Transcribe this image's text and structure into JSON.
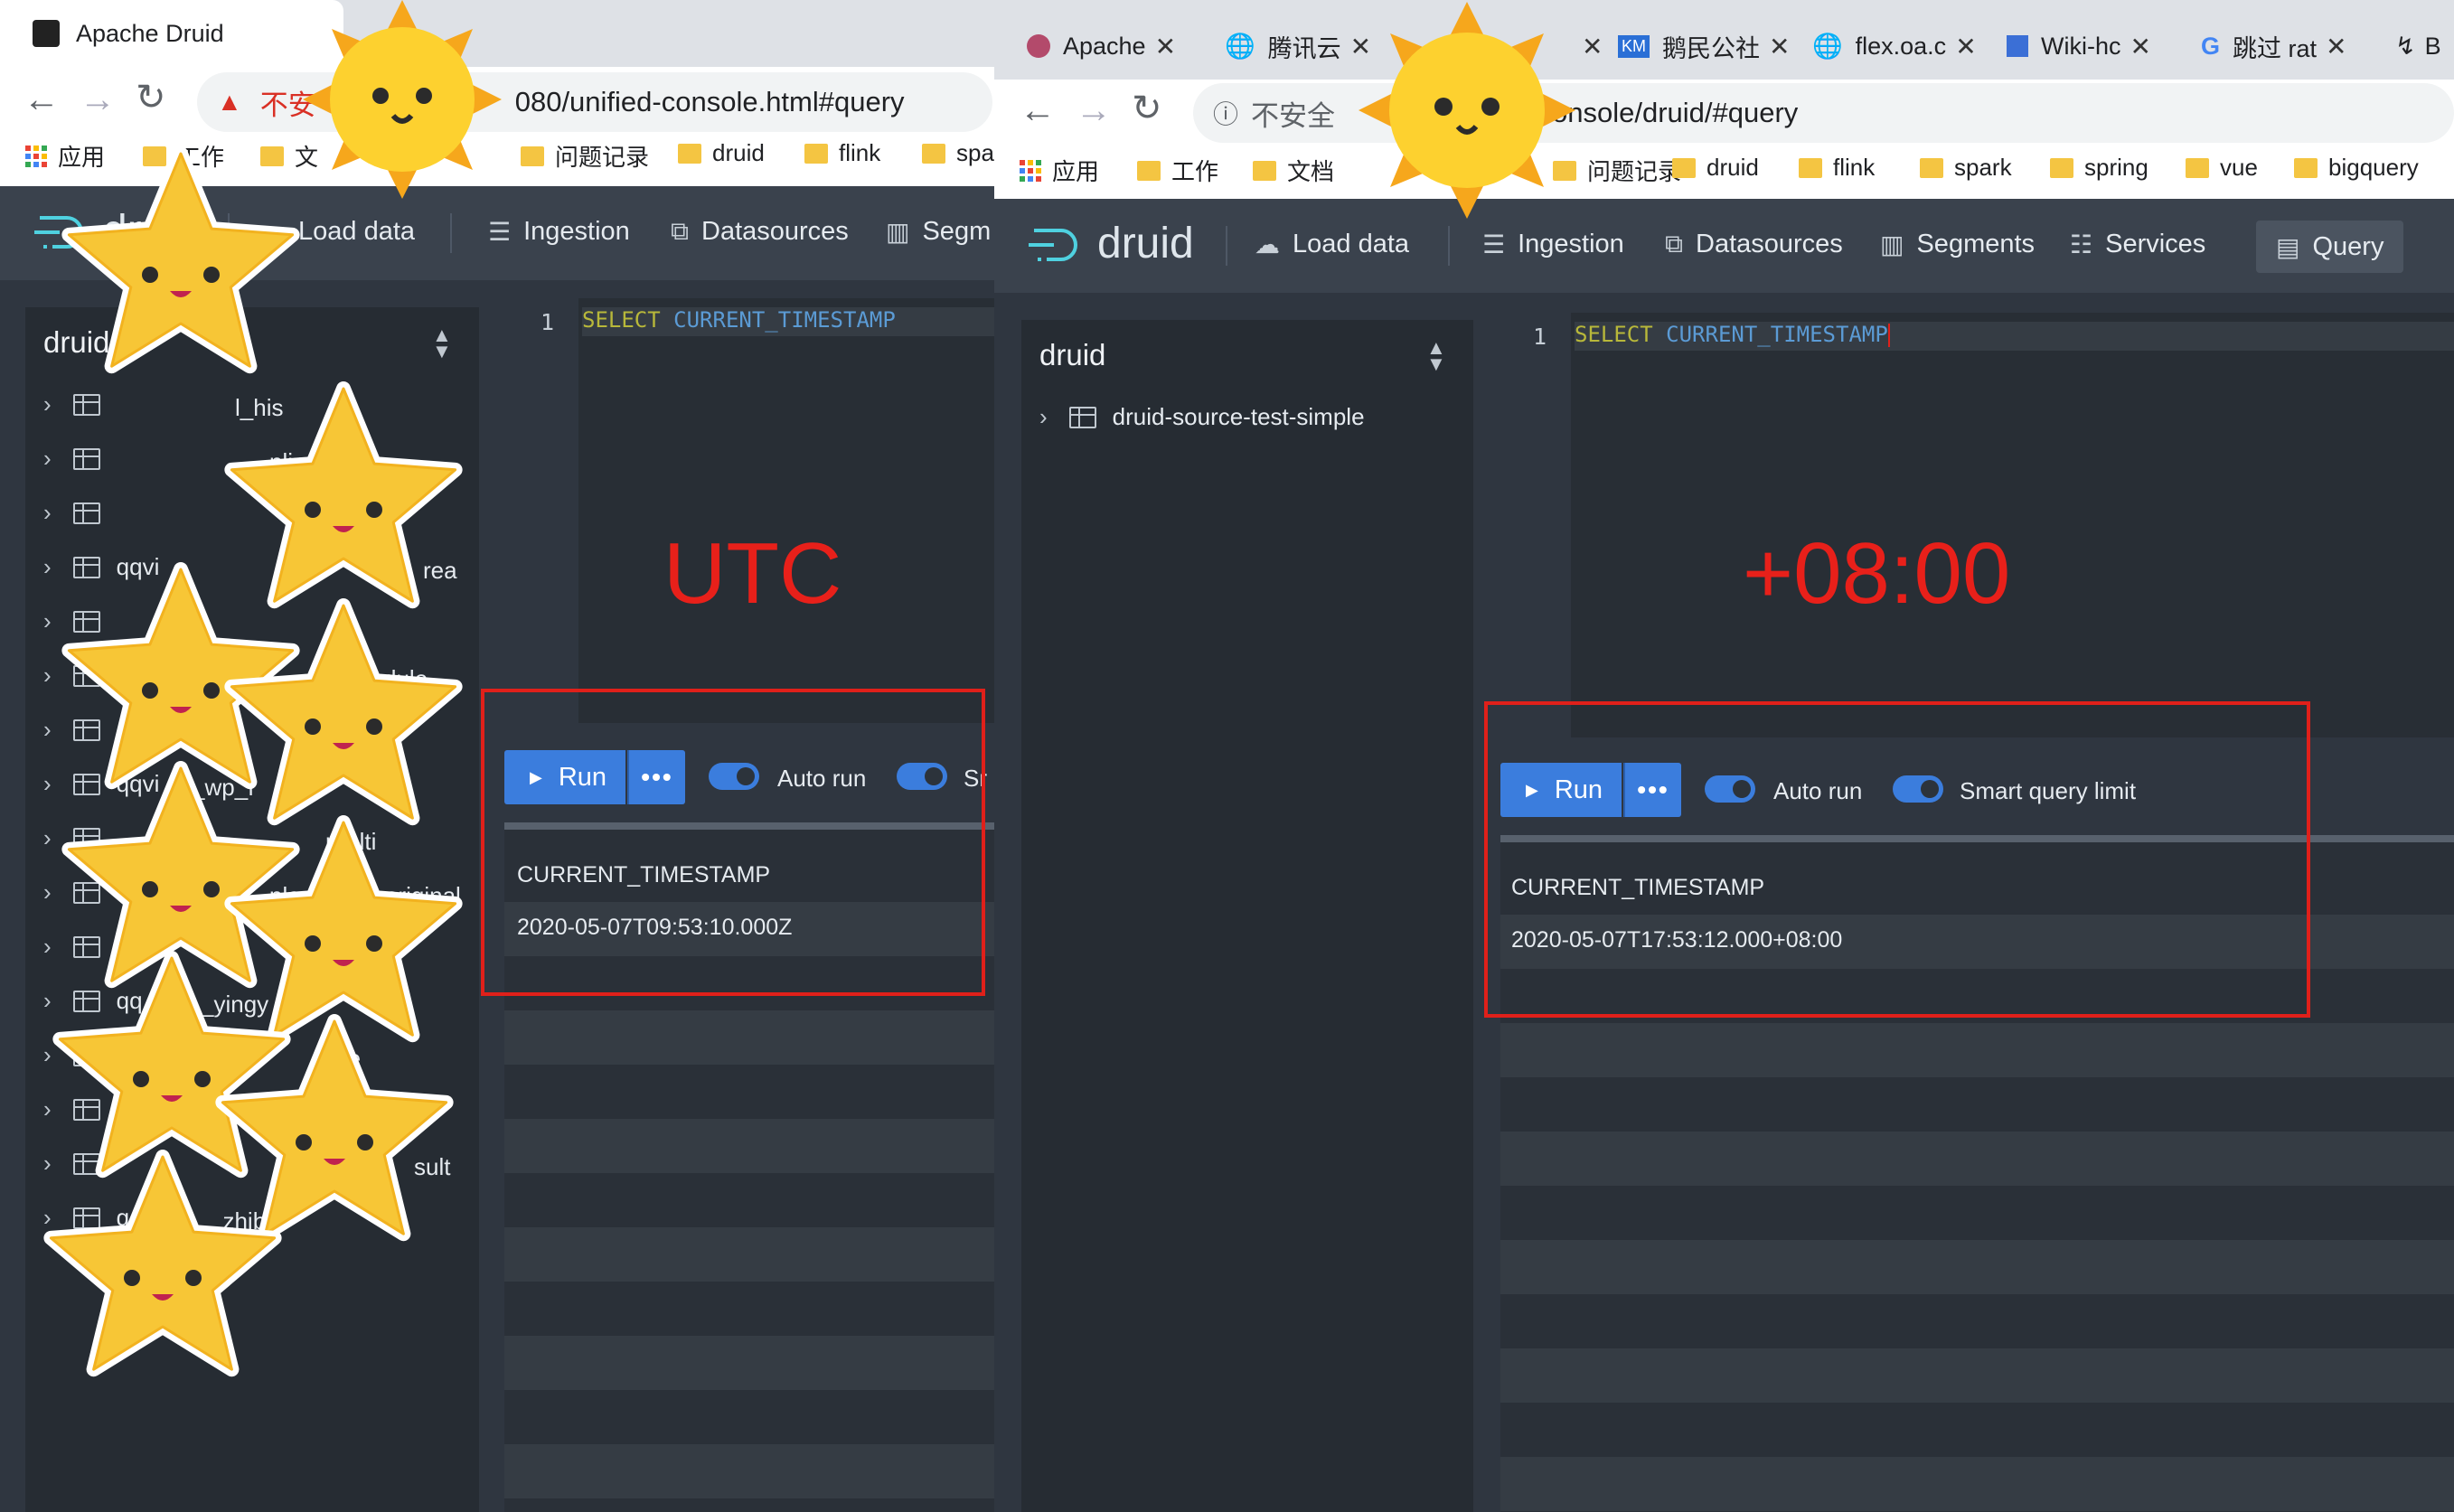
{
  "left_window": {
    "tab_title": "Apache Druid",
    "url_warning": "不安",
    "url_text": "080/unified-console.html#query",
    "bookmarks": [
      "应用",
      "工作",
      "文",
      "问题记录",
      "druid",
      "flink",
      "spa"
    ],
    "nav": [
      "Load data",
      "Ingestion",
      "Datasources",
      "Segm"
    ],
    "logo_text": "druid",
    "sidebar_title": "druid",
    "sidebar_items": [
      "",
      "",
      "",
      "qqvi",
      "",
      "",
      "",
      "qqvi",
      "",
      "",
      "",
      "qq",
      "",
      "",
      "",
      "q"
    ],
    "sidebar_fragments": [
      "l_his",
      "nline",
      "rea",
      "dule",
      "_wp_f",
      "realti",
      "plo",
      "original",
      "_yingy",
      "re",
      "sult",
      "_zhib"
    ],
    "editor": {
      "line_number": "1",
      "keyword": "SELECT",
      "function": "CURRENT_TIMESTAMP"
    },
    "annotation": "UTC",
    "run_label": "Run",
    "more_label": "•••",
    "toggle1_label": "Auto run",
    "toggle2_label": "Sr",
    "result_header": "CURRENT_TIMESTAMP",
    "result_value": "2020-05-07T09:53:10.000Z"
  },
  "right_window": {
    "tabs": [
      {
        "label": "Apache",
        "close": "✕"
      },
      {
        "label": "腾讯云",
        "close": "✕"
      },
      {
        "label": "",
        "close": "✕"
      },
      {
        "label": "鹅民公社",
        "close": "✕"
      },
      {
        "label": "flex.oa.c",
        "close": "✕"
      },
      {
        "label": "Wiki-hc",
        "close": "✕"
      },
      {
        "label": "跳过 rat",
        "close": "✕"
      },
      {
        "label": "B",
        "close": ""
      }
    ],
    "url_warning": "不安全",
    "url_text": "onsole/druid/#query",
    "bookmarks": [
      "应用",
      "工作",
      "文档",
      "问题记录",
      "druid",
      "flink",
      "spark",
      "spring",
      "vue",
      "bigquery"
    ],
    "nav": [
      "Load data",
      "Ingestion",
      "Datasources",
      "Segments",
      "Services",
      "Query"
    ],
    "logo_text": "druid",
    "sidebar_title": "druid",
    "sidebar_items": [
      "druid-source-test-simple"
    ],
    "editor": {
      "line_number": "1",
      "keyword": "SELECT",
      "function": "CURRENT_TIMESTAMP"
    },
    "annotation": "+08:00",
    "run_label": "Run",
    "more_label": "•••",
    "toggle1_label": "Auto run",
    "toggle2_label": "Smart query limit",
    "result_header": "CURRENT_TIMESTAMP",
    "result_value": "2020-05-07T17:53:12.000+08:00"
  },
  "colors": {
    "annotation_red": "#e0201a",
    "accent_blue": "#3b7ddd",
    "console_bg": "#2f3640"
  }
}
